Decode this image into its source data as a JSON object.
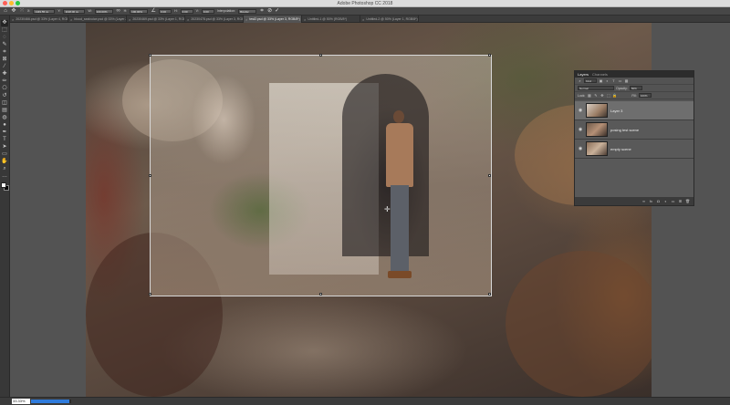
{
  "app": {
    "title": "Adobe Photoshop CC 2018"
  },
  "window": {
    "traffic_colors": [
      "#fe5f57",
      "#febc2e",
      "#28c840"
    ]
  },
  "options_bar": {
    "move_icon": "move-icon",
    "reference_point_icon": "reference-point-icon",
    "x_value": "1449.55 px",
    "y_value": "1138.00 px",
    "width_value": "100.00%",
    "height_value": "100.00%",
    "angle_value": "0.00",
    "h_skew": "0.00",
    "v_skew": "0.00",
    "interpolation_label": "Interpolation:",
    "interpolation_value": "Bicubic",
    "cancel_icon": "cancel-icon",
    "commit_icon": "commit-icon"
  },
  "tabs": [
    {
      "label": "20230466.psd @ 33% (Layer 4, RGB/8*)",
      "active": false
    },
    {
      "label": "blood_sealvoice.psd @ 33% (Layer 2, RGB/8*)",
      "active": false
    },
    {
      "label": "20230469.psd @ 33% (Layer 1, RGB/8*)",
      "active": false
    },
    {
      "label": "20230478.psd @ 33% (Layer 3, RGB/8*)",
      "active": false
    },
    {
      "label": "test2.psd @ 33% (Layer 3, RGB/8*)",
      "active": true
    },
    {
      "label": "Untitled-1 @ 50% (RGB/8*)",
      "active": false
    },
    {
      "label": "Untitled-2 @ 50% (Layer 1, RGB/8*)",
      "active": false
    }
  ],
  "tools": [
    "move-tool",
    "marquee-tool",
    "lasso-tool",
    "quick-select-tool",
    "crop-tool",
    "frame-tool",
    "eyedropper-tool",
    "healing-tool",
    "brush-tool",
    "clone-stamp-tool",
    "history-brush-tool",
    "eraser-tool",
    "gradient-tool",
    "blur-tool",
    "dodge-tool",
    "pen-tool",
    "type-tool",
    "path-select-tool",
    "shape-tool",
    "hand-tool",
    "zoom-tool",
    "more-tools"
  ],
  "colors": {
    "foreground": "#ffffff",
    "background": "#000000",
    "accent": "#2f7bdc"
  },
  "layers_panel": {
    "tabs": [
      "Layers",
      "Channels"
    ],
    "kind_label": "Kind",
    "blend_mode": "Normal",
    "opacity_label": "Opacity:",
    "opacity_value": "50%",
    "lock_label": "Lock:",
    "fill_label": "Fill:",
    "fill_value": "100%",
    "layers": [
      {
        "name": "Layer 3",
        "visible": true,
        "selected": true
      },
      {
        "name": "posing test scene",
        "visible": true,
        "selected": false
      },
      {
        "name": "empty scene",
        "visible": true,
        "selected": false
      }
    ],
    "footer_icons": [
      "link-icon",
      "fx-icon",
      "mask-icon",
      "adjustment-icon",
      "folder-icon",
      "new-layer-icon",
      "trash-icon"
    ]
  },
  "status": {
    "zoom": "33.33%",
    "progress": 0.95
  }
}
